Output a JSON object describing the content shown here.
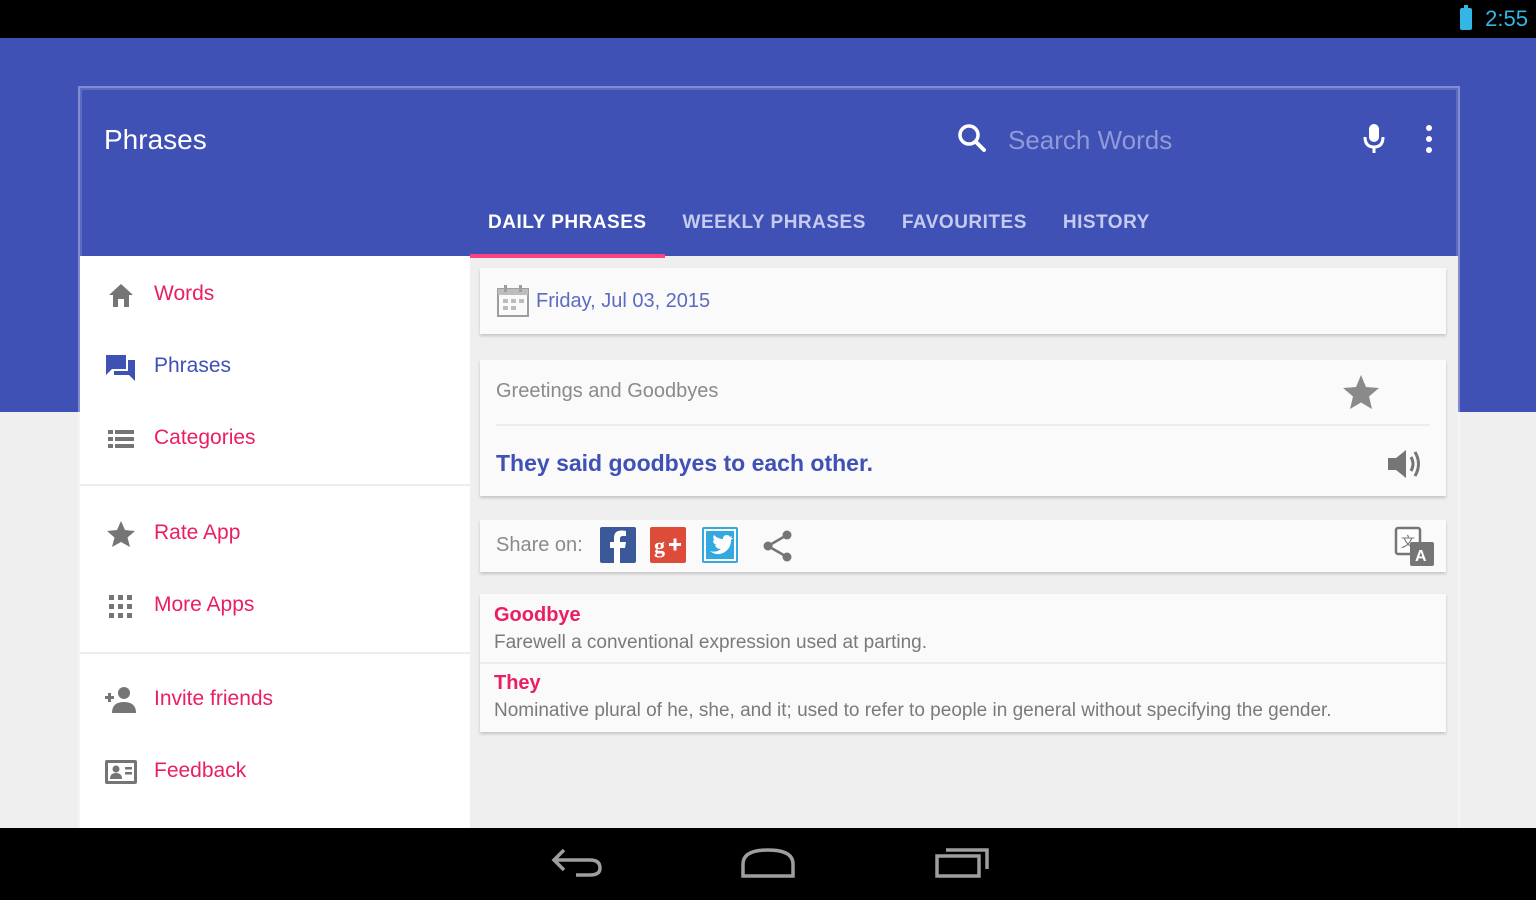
{
  "status_bar": {
    "time": "2:55"
  },
  "app": {
    "title": "Phrases"
  },
  "search": {
    "placeholder": "Search Words"
  },
  "tabs": [
    {
      "label": "DAILY PHRASES",
      "active": true
    },
    {
      "label": "WEEKLY PHRASES",
      "active": false
    },
    {
      "label": "FAVOURITES",
      "active": false
    },
    {
      "label": "HISTORY",
      "active": false
    }
  ],
  "drawer": {
    "items": [
      {
        "label": "Words",
        "icon": "home-icon"
      },
      {
        "label": "Phrases",
        "icon": "chat-icon",
        "active": true
      },
      {
        "label": "Categories",
        "icon": "list-icon"
      },
      {
        "label": "Rate App",
        "icon": "star-icon"
      },
      {
        "label": "More Apps",
        "icon": "grid-icon"
      },
      {
        "label": "Invite friends",
        "icon": "add-person-icon"
      },
      {
        "label": "Feedback",
        "icon": "contact-card-icon"
      }
    ]
  },
  "daily": {
    "date": "Friday, Jul 03, 2015",
    "category": "Greetings and Goodbyes",
    "phrase": "They said goodbyes to each other."
  },
  "share": {
    "label": "Share on:",
    "networks": [
      "facebook-icon",
      "google-plus-icon",
      "twitter-icon",
      "share-icon"
    ]
  },
  "words": [
    {
      "word": "Goodbye",
      "definition": "Farewell a conventional expression used at parting."
    },
    {
      "word": "They",
      "definition": "Nominative plural of he, she, and it; used to refer to people in general without specifying the gender."
    }
  ],
  "colors": {
    "primary": "#3f51b5",
    "accent": "#e91e63",
    "tab_indicator": "#ff4081",
    "background": "#efefef"
  }
}
